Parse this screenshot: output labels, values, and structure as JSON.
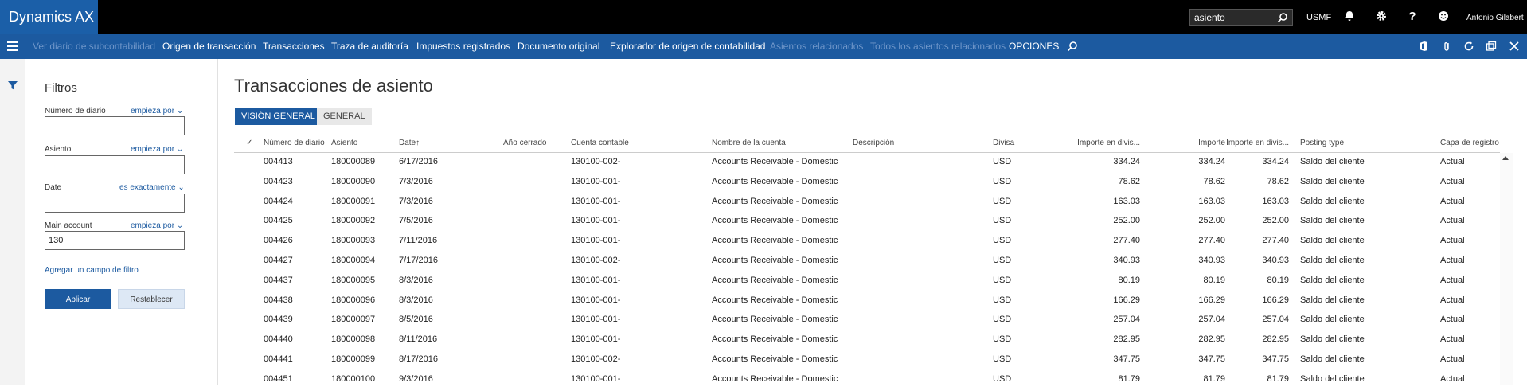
{
  "app": {
    "brand": "Dynamics AX"
  },
  "topbar": {
    "search_value": "asiento",
    "company": "USMF",
    "user": "Antonio Gilabert",
    "icons": [
      "search-icon",
      "bell-icon",
      "gear-icon",
      "help-icon",
      "smiley-icon"
    ]
  },
  "actions": {
    "items": [
      {
        "label": "Ver diario de subcontabilidad",
        "enabled": false
      },
      {
        "label": "Origen de transacción",
        "enabled": true
      },
      {
        "label": "Transacciones",
        "enabled": true
      },
      {
        "label": "Traza de auditoría",
        "enabled": true
      },
      {
        "label": "Impuestos registrados",
        "enabled": true
      },
      {
        "label": "Documento original",
        "enabled": true
      },
      {
        "label": "Explorador de origen de contabilidad",
        "enabled": true
      },
      {
        "label": "Asientos relacionados",
        "enabled": false
      },
      {
        "label": "Todos los asientos relacionados",
        "enabled": false
      },
      {
        "label": "OPCIONES",
        "enabled": true
      }
    ],
    "right_icons": [
      "office-icon",
      "attachment-icon",
      "refresh-icon",
      "popout-icon",
      "close-icon"
    ]
  },
  "filters": {
    "title": "Filtros",
    "fields": [
      {
        "label": "Número de diario",
        "operator": "empieza por",
        "value": ""
      },
      {
        "label": "Asiento",
        "operator": "empieza por",
        "value": ""
      },
      {
        "label": "Date",
        "operator": "es exactamente",
        "value": ""
      },
      {
        "label": "Main account",
        "operator": "empieza por",
        "value": "130"
      }
    ],
    "add_filter": "Agregar un campo de filtro",
    "apply": "Aplicar",
    "reset": "Restablecer"
  },
  "main": {
    "title": "Transacciones de asiento",
    "tabs": [
      "VISIÓN GENERAL",
      "GENERAL"
    ],
    "columns": [
      "Número de diario",
      "Asiento",
      "Date",
      "Año cerrado",
      "Cuenta contable",
      "Nombre de la cuenta",
      "Descripción",
      "Divisa",
      "Importe en divis...",
      "Importe",
      "Importe en divis...",
      "Posting type",
      "Capa de registro"
    ],
    "rows": [
      [
        "004413",
        "180000089",
        "6/17/2016",
        "",
        "130100-002-",
        "Accounts Receivable - Domestic",
        "",
        "USD",
        "334.24",
        "334.24",
        "334.24",
        "Saldo del cliente",
        "Actual"
      ],
      [
        "004423",
        "180000090",
        "7/3/2016",
        "",
        "130100-001-",
        "Accounts Receivable - Domestic",
        "",
        "USD",
        "78.62",
        "78.62",
        "78.62",
        "Saldo del cliente",
        "Actual"
      ],
      [
        "004424",
        "180000091",
        "7/3/2016",
        "",
        "130100-001-",
        "Accounts Receivable - Domestic",
        "",
        "USD",
        "163.03",
        "163.03",
        "163.03",
        "Saldo del cliente",
        "Actual"
      ],
      [
        "004425",
        "180000092",
        "7/5/2016",
        "",
        "130100-001-",
        "Accounts Receivable - Domestic",
        "",
        "USD",
        "252.00",
        "252.00",
        "252.00",
        "Saldo del cliente",
        "Actual"
      ],
      [
        "004426",
        "180000093",
        "7/11/2016",
        "",
        "130100-001-",
        "Accounts Receivable - Domestic",
        "",
        "USD",
        "277.40",
        "277.40",
        "277.40",
        "Saldo del cliente",
        "Actual"
      ],
      [
        "004427",
        "180000094",
        "7/17/2016",
        "",
        "130100-002-",
        "Accounts Receivable - Domestic",
        "",
        "USD",
        "340.93",
        "340.93",
        "340.93",
        "Saldo del cliente",
        "Actual"
      ],
      [
        "004437",
        "180000095",
        "8/3/2016",
        "",
        "130100-001-",
        "Accounts Receivable - Domestic",
        "",
        "USD",
        "80.19",
        "80.19",
        "80.19",
        "Saldo del cliente",
        "Actual"
      ],
      [
        "004438",
        "180000096",
        "8/3/2016",
        "",
        "130100-001-",
        "Accounts Receivable - Domestic",
        "",
        "USD",
        "166.29",
        "166.29",
        "166.29",
        "Saldo del cliente",
        "Actual"
      ],
      [
        "004439",
        "180000097",
        "8/5/2016",
        "",
        "130100-001-",
        "Accounts Receivable - Domestic",
        "",
        "USD",
        "257.04",
        "257.04",
        "257.04",
        "Saldo del cliente",
        "Actual"
      ],
      [
        "004440",
        "180000098",
        "8/11/2016",
        "",
        "130100-001-",
        "Accounts Receivable - Domestic",
        "",
        "USD",
        "282.95",
        "282.95",
        "282.95",
        "Saldo del cliente",
        "Actual"
      ],
      [
        "004441",
        "180000099",
        "8/17/2016",
        "",
        "130100-002-",
        "Accounts Receivable - Domestic",
        "",
        "USD",
        "347.75",
        "347.75",
        "347.75",
        "Saldo del cliente",
        "Actual"
      ],
      [
        "004451",
        "180000100",
        "9/3/2016",
        "",
        "130100-001-",
        "Accounts Receivable - Domestic",
        "",
        "USD",
        "81.79",
        "81.79",
        "81.79",
        "Saldo del cliente",
        "Actual"
      ]
    ]
  },
  "colors": {
    "brand": "#1b5fa8",
    "actionbar": "#1c5aa0",
    "disabled": "#6f96c9"
  }
}
